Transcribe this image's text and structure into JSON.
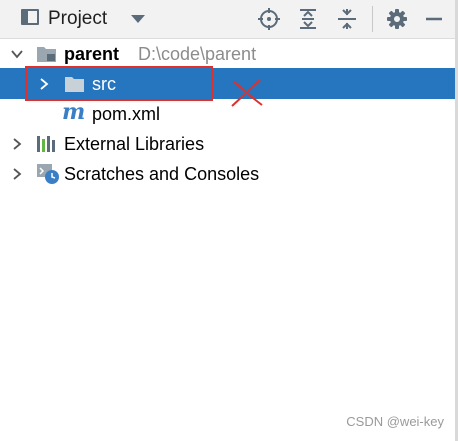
{
  "toolbar": {
    "title": "Project",
    "icons": [
      "project-view-icon",
      "dropdown-arrow-icon",
      "locate-crosshair-icon",
      "expand-all-icon",
      "collapse-all-icon",
      "gear-icon",
      "minimize-icon"
    ]
  },
  "tree": {
    "root": {
      "name": "parent",
      "path": "D:\\code\\parent",
      "icon": "module-folder-icon"
    },
    "children": [
      {
        "name": "src",
        "icon": "folder-icon",
        "selected": true
      },
      {
        "name": "pom.xml",
        "icon": "maven-icon"
      }
    ],
    "external_libraries": {
      "name": "External Libraries",
      "icon": "libraries-icon"
    },
    "scratches": {
      "name": "Scratches and Consoles",
      "icon": "scratches-icon"
    }
  },
  "colors": {
    "selection": "#2675bf",
    "annotation": "#e0302c",
    "toolbar_bg": "#f2f2f2"
  },
  "watermark": "CSDN @wei-key"
}
